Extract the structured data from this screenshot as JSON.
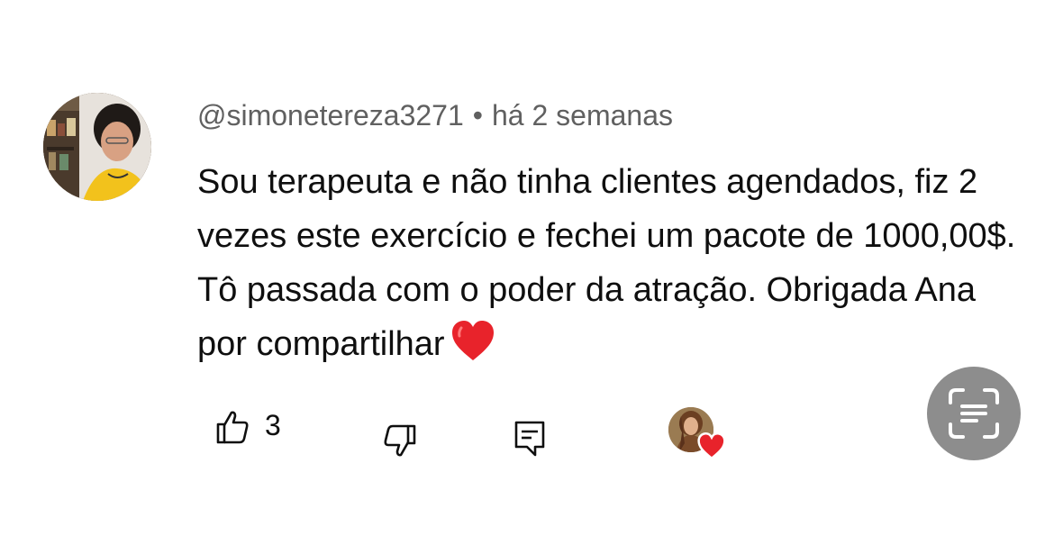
{
  "comment": {
    "author": "@simonetereza3271",
    "separator": "•",
    "timestamp": "há 2 semanas",
    "text": "Sou terapeuta e não tinha clientes agendados, fiz 2 vezes este exercício e fechei um pacote de 1000,00$. Tô passada com o poder da atração. Obrigada Ana por compartilhar",
    "emoji": "red-heart",
    "likes": "3"
  },
  "actions": {
    "like_icon": "thumbs-up-icon",
    "dislike_icon": "thumbs-down-icon",
    "reply_icon": "reply-icon",
    "creator_heart_icon": "creator-heart-icon"
  },
  "overlay": {
    "scan_icon": "text-scan-icon"
  },
  "colors": {
    "meta_text": "#606060",
    "body_text": "#0f0f0f",
    "heart": "#e8232b",
    "scan_button": "#8d8d8d"
  }
}
